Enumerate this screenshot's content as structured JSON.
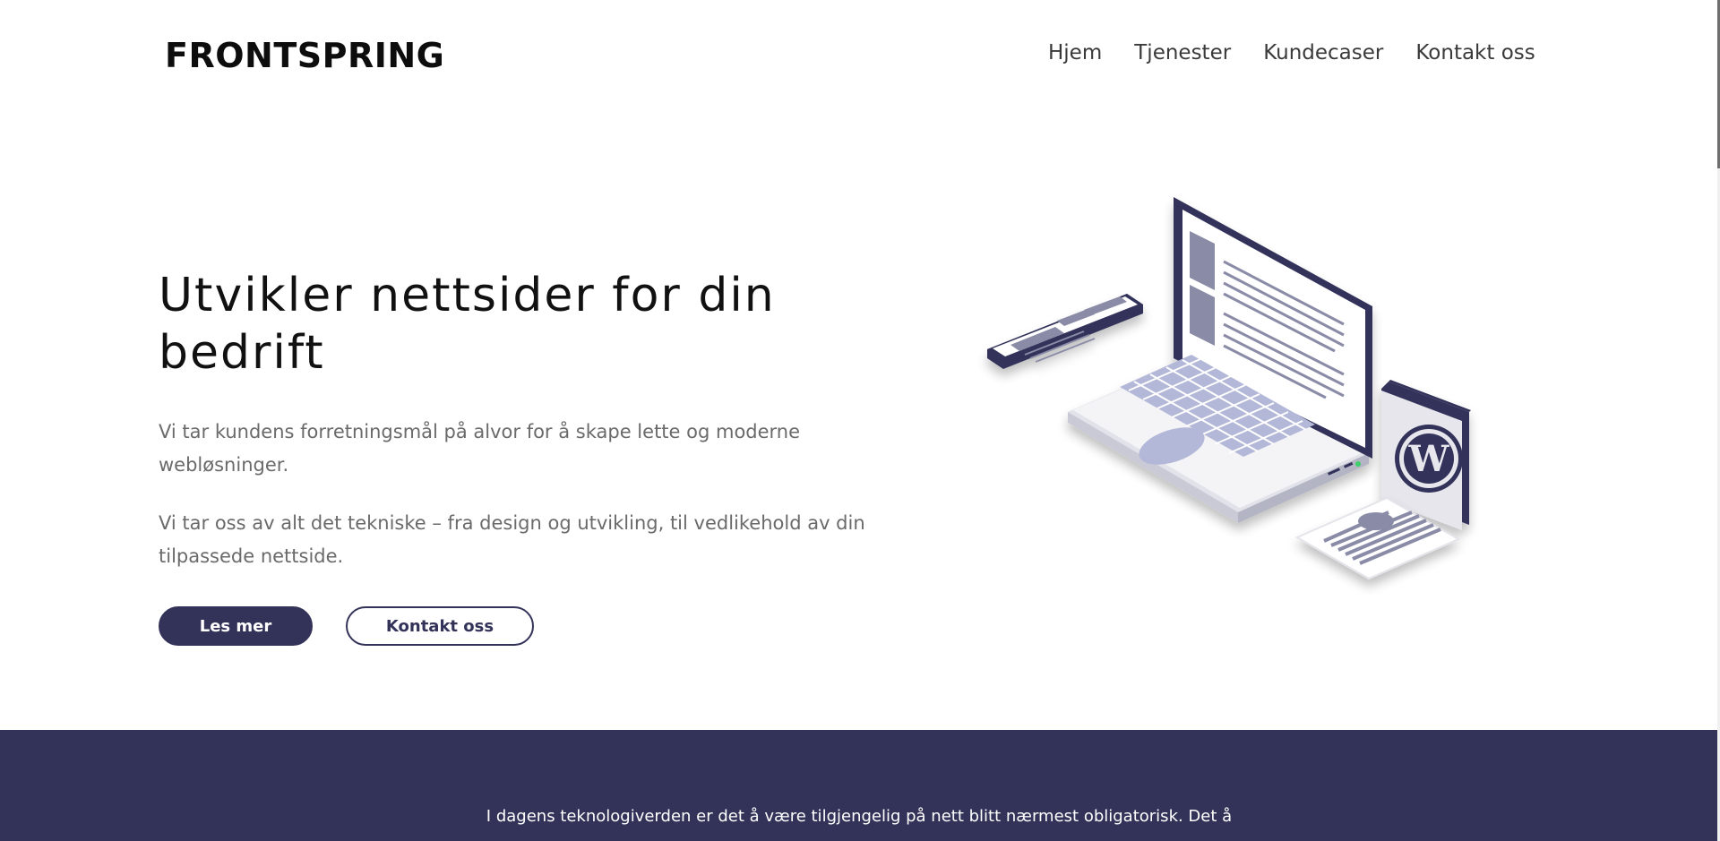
{
  "brand": {
    "logo": "FRONTSPRING"
  },
  "nav": {
    "items": [
      "Hjem",
      "Tjenester",
      "Kundecaser",
      "Kontakt oss"
    ]
  },
  "hero": {
    "title": "Utvikler nettsider for din bedrift",
    "paragraph1": "Vi tar kundens forretningsmål på alvor for å skape lette og moderne webløsninger.",
    "paragraph2": "Vi tar oss av alt det tekniske – fra design og utvikling, til vedlikehold av din tilpassede nettside.",
    "primary_button": "Les mer",
    "secondary_button": "Kontakt oss"
  },
  "band": {
    "text": "I dagens teknologiverden er det å være tilgjengelig på nett blitt nærmest obligatorisk. Det å"
  },
  "illustration": {
    "icons": [
      "laptop-icon",
      "phone-icon",
      "wordpress-icon",
      "document-icon"
    ]
  },
  "colors": {
    "accent": "#33335a",
    "illustration_light": "#b4b8d8",
    "illustration_mid": "#8a8ba6"
  }
}
